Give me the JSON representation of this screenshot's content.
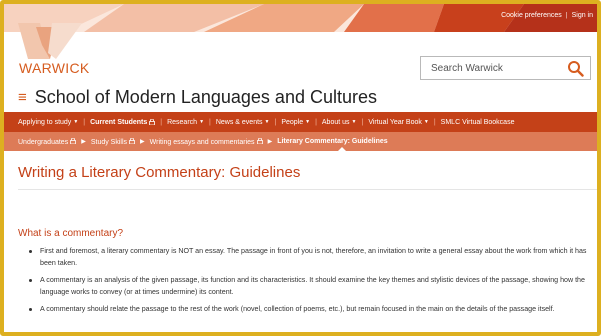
{
  "utility": {
    "cookie_label": "Cookie preferences",
    "signin_label": "Sign in"
  },
  "brand": {
    "logo_text": "WARWICK",
    "colors": {
      "accent": "#c44118",
      "logo": "#d65c1f",
      "frame": "#ddb020"
    }
  },
  "search": {
    "placeholder": "Search Warwick",
    "icon": "search-icon"
  },
  "dept": {
    "title": "School of Modern Languages and Cultures",
    "menu_icon": "hamburger-icon"
  },
  "nav": {
    "items": [
      {
        "label": "Applying to study",
        "caret": true
      },
      {
        "label": "Current Students",
        "bold": true,
        "lock": true
      },
      {
        "label": "Research",
        "caret": true
      },
      {
        "label": "News & events",
        "caret": true
      },
      {
        "label": "People",
        "caret": true
      },
      {
        "label": "About us",
        "caret": true
      },
      {
        "label": "Virtual Year Book",
        "caret": true
      },
      {
        "label": "SMLC Virtual Bookcase"
      }
    ]
  },
  "breadcrumb": {
    "items": [
      {
        "label": "Undergraduates",
        "lock": true
      },
      {
        "label": "Study Skills",
        "lock": true
      },
      {
        "label": "Writing essays and commentaries",
        "lock": true
      },
      {
        "label": "Literary Commentary: Guidelines",
        "current": true
      }
    ]
  },
  "page": {
    "title": "Writing a Literary Commentary: Guidelines",
    "section_heading": "What is a commentary?",
    "bullets": [
      "First and foremost, a literary commentary is NOT an essay. The passage in front of you is not, therefore, an invitation to write a general essay about the work from which it has been taken.",
      "A commentary is an analysis of the given passage, its function and its characteristics. It should examine the key themes and stylistic devices of the passage, showing how the language works to convey (or at times undermine) its content.",
      "A commentary should relate the passage to the rest of the work (novel, collection of poems, etc.), but remain focused in the main on the details of the passage itself."
    ]
  }
}
